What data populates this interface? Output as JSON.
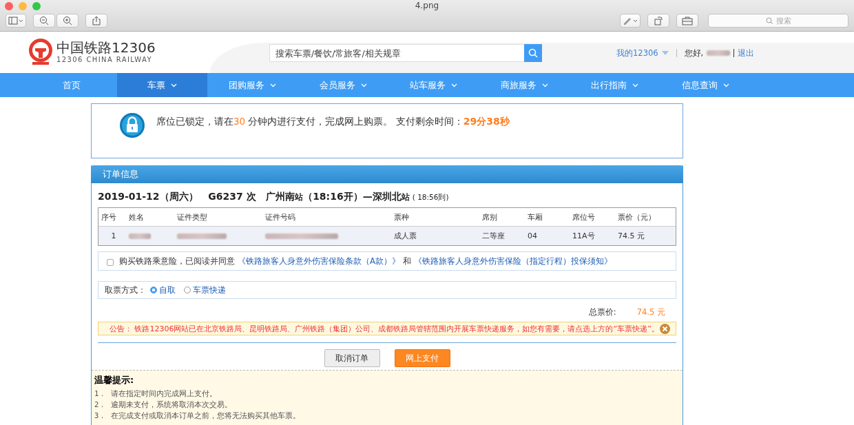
{
  "window": {
    "title": "4.png",
    "search_placeholder": "搜索"
  },
  "header": {
    "logo_cn": "中国铁路12306",
    "logo_en": "12306 CHINA RAILWAY",
    "search_placeholder": "搜索车票/餐饮/常旅客/相关规章",
    "my_account": "我的12306",
    "greeting": "您好,",
    "logout": "退出"
  },
  "nav": [
    {
      "label": "首页",
      "selected": false,
      "dropdown": false
    },
    {
      "label": "车票",
      "selected": true,
      "dropdown": true
    },
    {
      "label": "团购服务",
      "selected": false,
      "dropdown": true
    },
    {
      "label": "会员服务",
      "selected": false,
      "dropdown": true
    },
    {
      "label": "站车服务",
      "selected": false,
      "dropdown": true
    },
    {
      "label": "商旅服务",
      "selected": false,
      "dropdown": true
    },
    {
      "label": "出行指南",
      "selected": false,
      "dropdown": true
    },
    {
      "label": "信息查询",
      "selected": false,
      "dropdown": true
    }
  ],
  "lock_notice": {
    "text_before": "席位已锁定，请在",
    "minutes": "30",
    "text_after": " 分钟内进行支付，完成网上购票。 支付剩余时间：",
    "remaining": "29分38秒"
  },
  "order": {
    "title": "订单信息",
    "date": "2019-01-12（周六）",
    "train": "G6237 次",
    "from": "广州南",
    "from_suffix": "站",
    "depart": "（18:16开）—",
    "to": "深圳北",
    "to_suffix": "站",
    "arrive": "( 18:56到)",
    "columns": [
      "序号",
      "姓名",
      "证件类型",
      "证件号码",
      "票种",
      "席别",
      "车厢",
      "席位号",
      "票价（元）"
    ],
    "rows": [
      {
        "no": "1",
        "ticket_type": "成人票",
        "seat_class": "二等座",
        "car": "04",
        "seat": "11A号",
        "price": "74.5 元"
      }
    ],
    "insurance": {
      "checked": false,
      "text": "购买铁路乘意险，已阅读并同意",
      "link1": "《铁路旅客人身意外伤害保险条款（A款）》",
      "and": "和",
      "link2": "《铁路旅客人身意外伤害保险（指定行程）投保须知》"
    },
    "pickup_label": "取票方式：",
    "pickup_options": [
      {
        "label": "自取",
        "selected": true
      },
      {
        "label": "车票快递",
        "selected": false
      }
    ],
    "total_label": "总票价:",
    "total": "74.5 元",
    "announcement": "公告：  铁路12306网站已在北京铁路局、昆明铁路局、广州铁路（集团）公司、成都铁路局管辖范围内开展车票快递服务，如您有需要，请点选上方的“车票快递”。",
    "buttons": [
      "取消订单",
      "网上支付"
    ]
  },
  "tips": {
    "title": "温馨提示:",
    "items": [
      "1． 请在指定时间内完成网上支付。",
      "2． 逾期未支付，系统将取消本次交易。",
      "3． 在完成支付或取消本订单之前，您将无法购买其他车票。"
    ]
  }
}
